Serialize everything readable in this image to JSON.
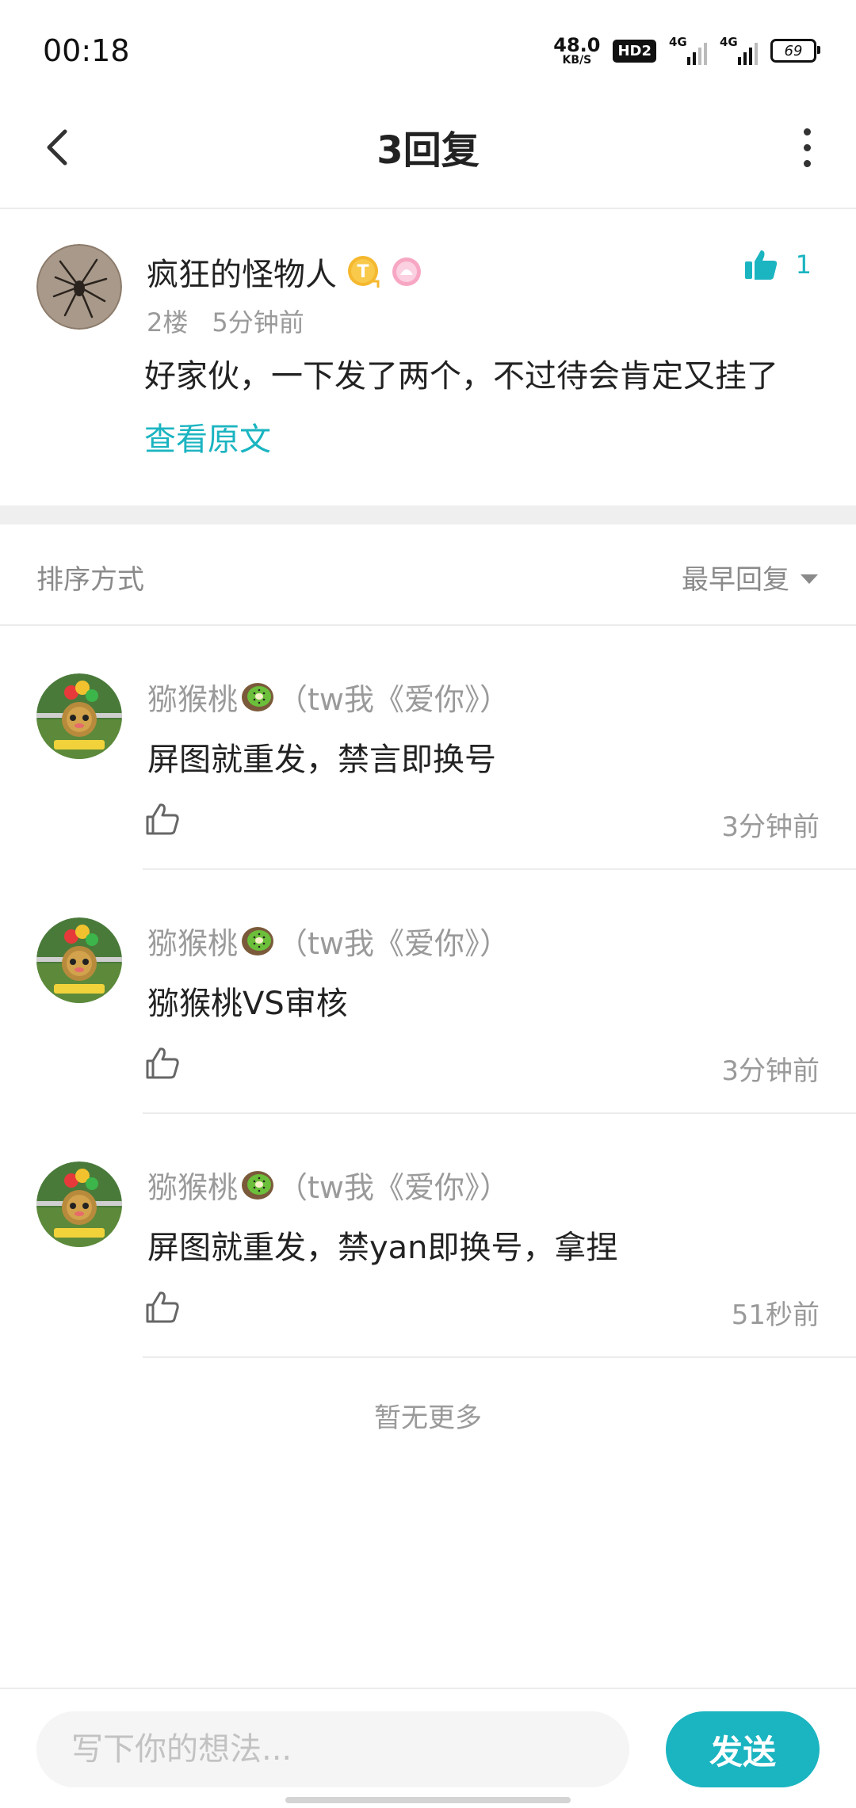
{
  "status_bar": {
    "time": "00:18",
    "net_speed": "48.0",
    "net_unit": "KB/S",
    "hd_label": "HD2",
    "signal1_label": "4G",
    "signal2_label": "4G",
    "battery": "69"
  },
  "nav": {
    "title": "3回复",
    "back_icon": "back-chevron-icon",
    "more_icon": "more-vertical-icon"
  },
  "post": {
    "username": "疯狂的怪物人",
    "badge_icon": "t-medal-icon",
    "badge2_icon": "pink-badge-icon",
    "likes": "1",
    "floor": "2楼",
    "time": "5分钟前",
    "content": "好家伙，一下发了两个，不过待会肯定又挂了",
    "view_original": "查看原文"
  },
  "sort": {
    "label": "排序方式",
    "selected": "最早回复"
  },
  "replies": [
    {
      "name_prefix": "猕猴桃",
      "name_suffix": "（tw我《爱你》）",
      "text": "屏图就重发，禁言即换号",
      "time": "3分钟前"
    },
    {
      "name_prefix": "猕猴桃",
      "name_suffix": "（tw我《爱你》）",
      "text": "猕猴桃VS审核",
      "time": "3分钟前"
    },
    {
      "name_prefix": "猕猴桃",
      "name_suffix": "（tw我《爱你》）",
      "text": "屏图就重发，禁yan即换号，拿捏",
      "time": "51秒前"
    }
  ],
  "no_more": "暂无更多",
  "composer": {
    "placeholder": "写下你的想法...",
    "send": "发送"
  },
  "colors": {
    "accent": "#1bb4c1",
    "muted_text": "#9a9a9a",
    "primary_text": "#222222"
  }
}
